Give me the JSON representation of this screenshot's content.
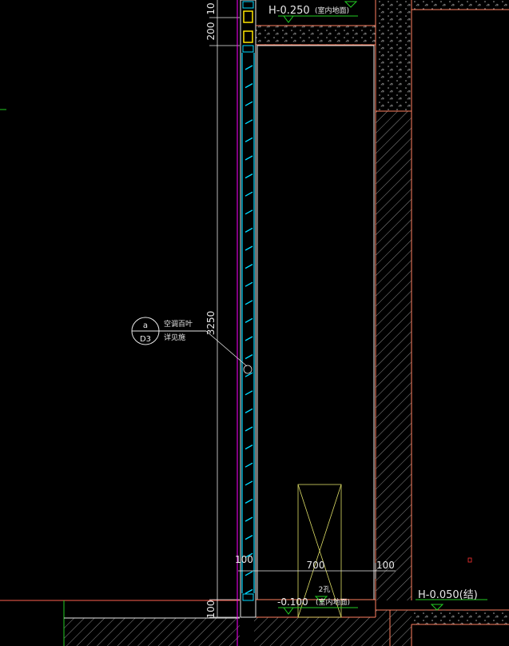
{
  "dimensions": {
    "top_partial": "10",
    "upper": "200",
    "height": "3250",
    "bottom": "100",
    "left_width": "100",
    "opening_width": "700",
    "right_width": "100"
  },
  "levels": {
    "top_value": "H-0.250",
    "top_note": "(室内地面)",
    "bottom_value": "-0.100",
    "bottom_note": "(室内地面)",
    "right_value": "H-0.050(结)"
  },
  "detail_callout": {
    "number": "a",
    "sheet": "D3",
    "note_line1": "空调百叶",
    "note_line2": "详见施"
  },
  "notes": {
    "opening_tag": "2孔"
  },
  "colors": {
    "background": "#000000",
    "wall_outline": "#ff8060",
    "louver": "#00d8ff",
    "frame": "#e8e8e8",
    "symbol_green": "#22cc22",
    "yellow": "#ffe600",
    "magenta": "#ff00ff",
    "box": "#dddd66"
  }
}
